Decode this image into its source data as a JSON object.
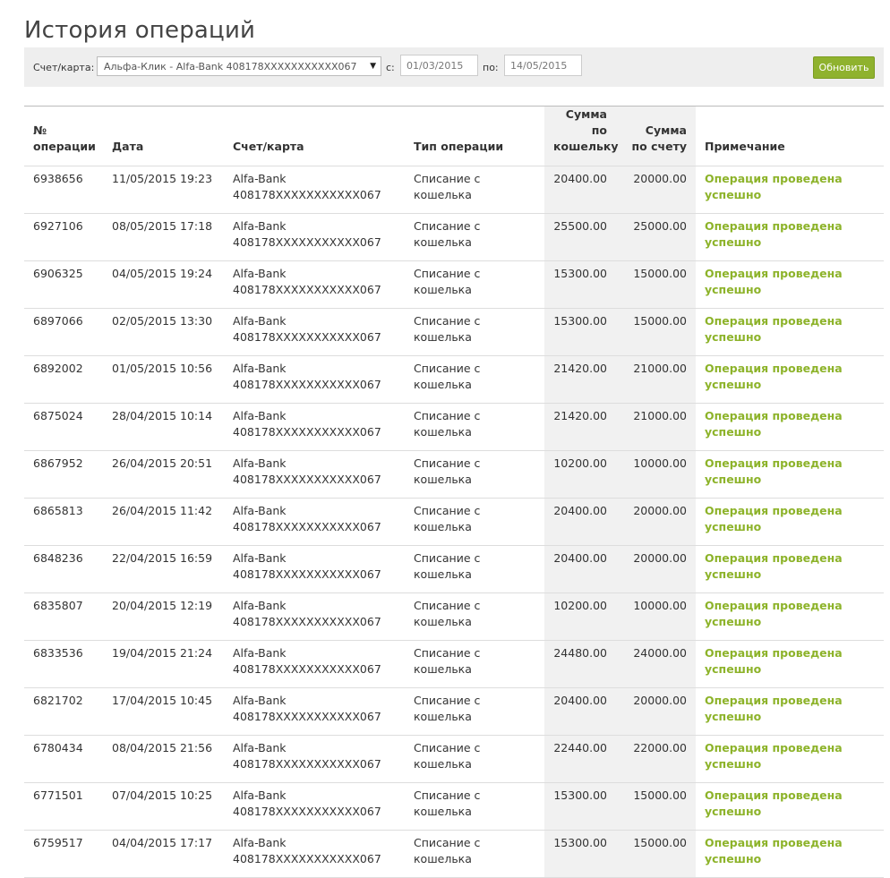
{
  "page": {
    "title": "История операций"
  },
  "filter": {
    "account_label": "Счет/карта:",
    "account_value": "Альфа-Клик - Alfa-Bank 408178XXXXXXXXXXX067",
    "from_label": "с:",
    "from_value": "01/03/2015",
    "to_label": "по:",
    "to_value": "14/05/2015",
    "refresh_label": "Обновить"
  },
  "table": {
    "headers": {
      "op_num_1": "№",
      "op_num_2": "операции",
      "date": "Дата",
      "account": "Счет/карта",
      "type": "Тип операции",
      "wallet_sum_1": "Сумма по",
      "wallet_sum_2": "кошельку",
      "account_sum_1": "Сумма",
      "account_sum_2": "по счету",
      "note": "Примечание"
    },
    "rows": [
      {
        "id": "6938656",
        "date": "11/05/2015 19:23",
        "bank": "Alfa-Bank",
        "acct": "408178XXXXXXXXXXX067",
        "type": "Списание с кошелька",
        "wallet": "20400.00",
        "account": "20000.00",
        "note": "Операция проведена успешно"
      },
      {
        "id": "6927106",
        "date": "08/05/2015 17:18",
        "bank": "Alfa-Bank",
        "acct": "408178XXXXXXXXXXX067",
        "type": "Списание с кошелька",
        "wallet": "25500.00",
        "account": "25000.00",
        "note": "Операция проведена успешно"
      },
      {
        "id": "6906325",
        "date": "04/05/2015 19:24",
        "bank": "Alfa-Bank",
        "acct": "408178XXXXXXXXXXX067",
        "type": "Списание с кошелька",
        "wallet": "15300.00",
        "account": "15000.00",
        "note": "Операция проведена успешно"
      },
      {
        "id": "6897066",
        "date": "02/05/2015 13:30",
        "bank": "Alfa-Bank",
        "acct": "408178XXXXXXXXXXX067",
        "type": "Списание с кошелька",
        "wallet": "15300.00",
        "account": "15000.00",
        "note": "Операция проведена успешно"
      },
      {
        "id": "6892002",
        "date": "01/05/2015 10:56",
        "bank": "Alfa-Bank",
        "acct": "408178XXXXXXXXXXX067",
        "type": "Списание с кошелька",
        "wallet": "21420.00",
        "account": "21000.00",
        "note": "Операция проведена успешно"
      },
      {
        "id": "6875024",
        "date": "28/04/2015 10:14",
        "bank": "Alfa-Bank",
        "acct": "408178XXXXXXXXXXX067",
        "type": "Списание с кошелька",
        "wallet": "21420.00",
        "account": "21000.00",
        "note": "Операция проведена успешно"
      },
      {
        "id": "6867952",
        "date": "26/04/2015 20:51",
        "bank": "Alfa-Bank",
        "acct": "408178XXXXXXXXXXX067",
        "type": "Списание с кошелька",
        "wallet": "10200.00",
        "account": "10000.00",
        "note": "Операция проведена успешно"
      },
      {
        "id": "6865813",
        "date": "26/04/2015 11:42",
        "bank": "Alfa-Bank",
        "acct": "408178XXXXXXXXXXX067",
        "type": "Списание с кошелька",
        "wallet": "20400.00",
        "account": "20000.00",
        "note": "Операция проведена успешно"
      },
      {
        "id": "6848236",
        "date": "22/04/2015 16:59",
        "bank": "Alfa-Bank",
        "acct": "408178XXXXXXXXXXX067",
        "type": "Списание с кошелька",
        "wallet": "20400.00",
        "account": "20000.00",
        "note": "Операция проведена успешно"
      },
      {
        "id": "6835807",
        "date": "20/04/2015 12:19",
        "bank": "Alfa-Bank",
        "acct": "408178XXXXXXXXXXX067",
        "type": "Списание с кошелька",
        "wallet": "10200.00",
        "account": "10000.00",
        "note": "Операция проведена успешно"
      },
      {
        "id": "6833536",
        "date": "19/04/2015 21:24",
        "bank": "Alfa-Bank",
        "acct": "408178XXXXXXXXXXX067",
        "type": "Списание с кошелька",
        "wallet": "24480.00",
        "account": "24000.00",
        "note": "Операция проведена успешно"
      },
      {
        "id": "6821702",
        "date": "17/04/2015 10:45",
        "bank": "Alfa-Bank",
        "acct": "408178XXXXXXXXXXX067",
        "type": "Списание с кошелька",
        "wallet": "20400.00",
        "account": "20000.00",
        "note": "Операция проведена успешно"
      },
      {
        "id": "6780434",
        "date": "08/04/2015 21:56",
        "bank": "Alfa-Bank",
        "acct": "408178XXXXXXXXXXX067",
        "type": "Списание с кошелька",
        "wallet": "22440.00",
        "account": "22000.00",
        "note": "Операция проведена успешно"
      },
      {
        "id": "6771501",
        "date": "07/04/2015 10:25",
        "bank": "Alfa-Bank",
        "acct": "408178XXXXXXXXXXX067",
        "type": "Списание с кошелька",
        "wallet": "15300.00",
        "account": "15000.00",
        "note": "Операция проведена успешно"
      },
      {
        "id": "6759517",
        "date": "04/04/2015 17:17",
        "bank": "Alfa-Bank",
        "acct": "408178XXXXXXXXXXX067",
        "type": "Списание с кошелька",
        "wallet": "15300.00",
        "account": "15000.00",
        "note": "Операция проведена успешно"
      }
    ]
  },
  "colors": {
    "accent_green": "#8fb22e",
    "note_green": "#8db32a"
  }
}
